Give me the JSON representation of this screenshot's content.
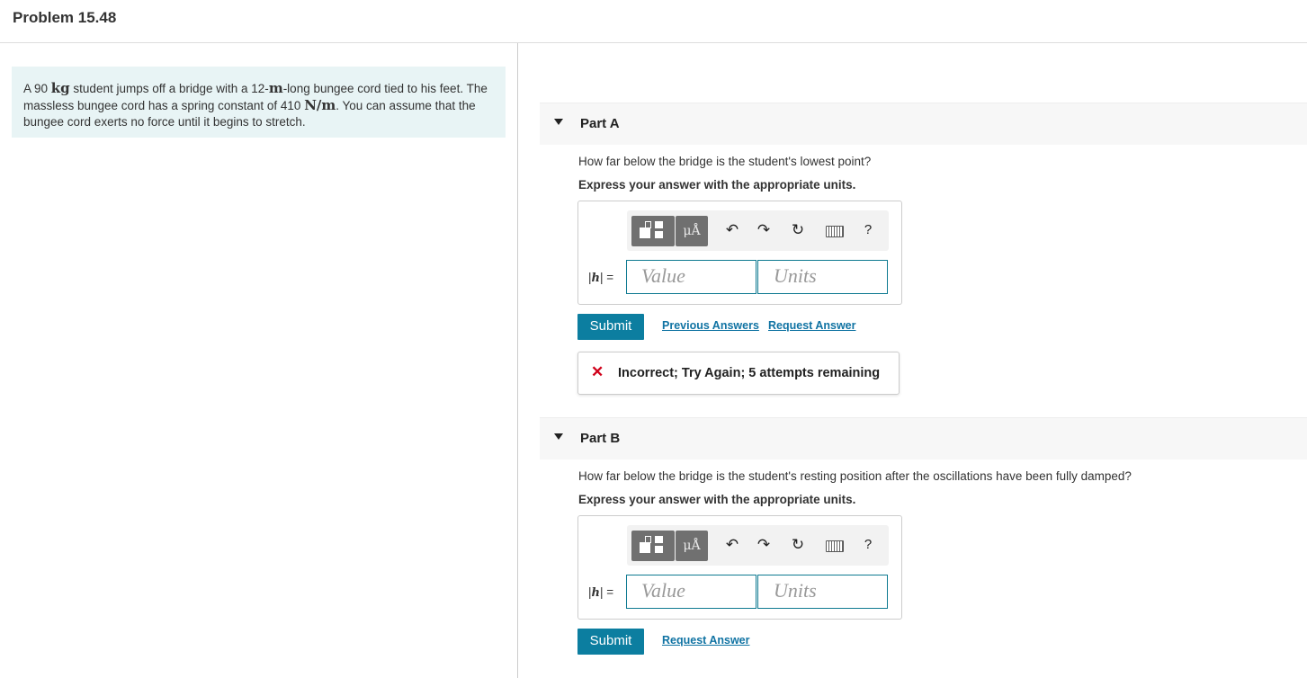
{
  "header": {
    "title": "Problem 15.48"
  },
  "problem": {
    "t1": "A 90 ",
    "u1": "kg",
    "t2": " student jumps off a bridge with a 12-",
    "u2": "m",
    "t3": "-long bungee cord tied to his feet. The massless bungee cord has a spring constant of 410 ",
    "u3": "N/m",
    "t4": ". You can assume that the bungee cord exerts no force until it begins to stretch."
  },
  "toolbar": {
    "units_label": "μÅ",
    "icons": [
      "templates-icon",
      "units-icon",
      "undo-icon",
      "redo-icon",
      "reset-icon",
      "keyboard-icon",
      "help-icon"
    ],
    "undo_glyph": "↶",
    "redo_glyph": "↷",
    "reset_glyph": "↻",
    "help_label": "?"
  },
  "parts": [
    {
      "label": "Part A",
      "question": "How far below the bridge is the student's lowest point?",
      "instruction": "Express your answer with the appropriate units.",
      "var_label": "|h| =",
      "var_open": "|",
      "var_name": "h",
      "var_close": "| =",
      "value_placeholder": "Value",
      "units_placeholder": "Units",
      "submit_label": "Submit",
      "previous_answers_label": "Previous Answers",
      "request_answer_label": "Request Answer",
      "feedback": {
        "icon": "x-icon",
        "glyph": "✕",
        "message": "Incorrect; Try Again; 5 attempts remaining",
        "color": "#d0021b"
      }
    },
    {
      "label": "Part B",
      "question": "How far below the bridge is the student's resting position after the oscillations have been fully damped?",
      "instruction": "Express your answer with the appropriate units.",
      "var_label": "|h| =",
      "var_open": "|",
      "var_name": "h",
      "var_close": "| =",
      "value_placeholder": "Value",
      "units_placeholder": "Units",
      "submit_label": "Submit",
      "request_answer_label": "Request Answer"
    }
  ],
  "colors": {
    "accent": "#0c7ea0",
    "link": "#1073a3",
    "problem_bg": "#e8f4f5",
    "error": "#d0021b"
  }
}
